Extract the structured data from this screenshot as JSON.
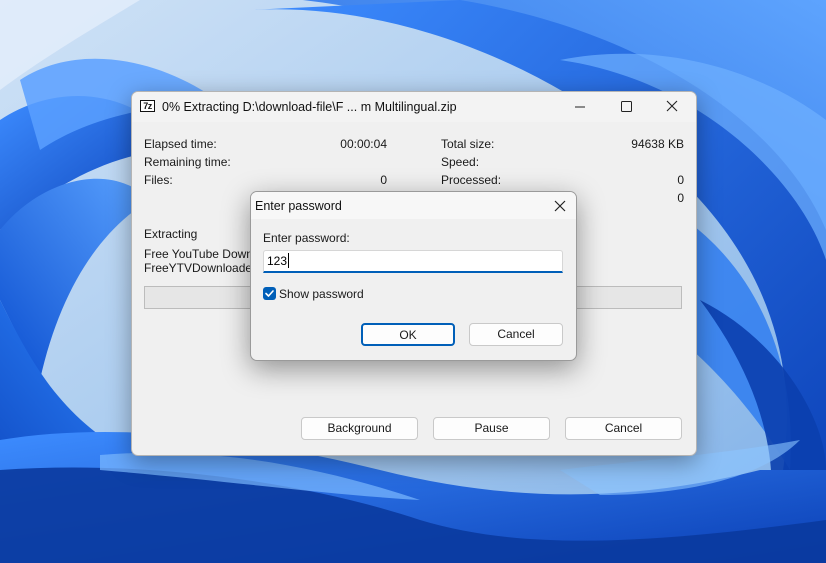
{
  "colors": {
    "accent": "#005fb8",
    "progress_fill": "#06b025",
    "wallpaper_base": "#9fc3ea",
    "wallpaper_bloom": "#1a6fe8"
  },
  "main_window": {
    "app_icon_text": "7z",
    "title": "0% Extracting D:\\download-file\\F ... m Multilingual.zip",
    "caption_icons": [
      "minimize-icon",
      "maximize-icon",
      "close-icon"
    ],
    "stats_left": {
      "elapsed_label": "Elapsed time:",
      "elapsed_value": "00:00:04",
      "remaining_label": "Remaining time:",
      "files_label": "Files:",
      "files_value": "0"
    },
    "stats_right": {
      "total_size_label": "Total size:",
      "total_size_value": "94638 KB",
      "speed_label": "Speed:",
      "processed_label": "Processed:",
      "processed_value": "0",
      "compressed_value": "0"
    },
    "extracting_label": "Extracting",
    "current_files": [
      "Free YouTube Downlo",
      "FreeYTVDownloader.e"
    ],
    "progress_percent": 0,
    "buttons": {
      "background": "Background",
      "pause": "Pause",
      "cancel": "Cancel"
    }
  },
  "password_dialog": {
    "title": "Enter password",
    "close_icon": "close-icon",
    "field_label": "Enter password:",
    "field_value": "123",
    "show_password_label": "Show password",
    "show_password_checked": true,
    "ok_label": "OK",
    "cancel_label": "Cancel"
  }
}
